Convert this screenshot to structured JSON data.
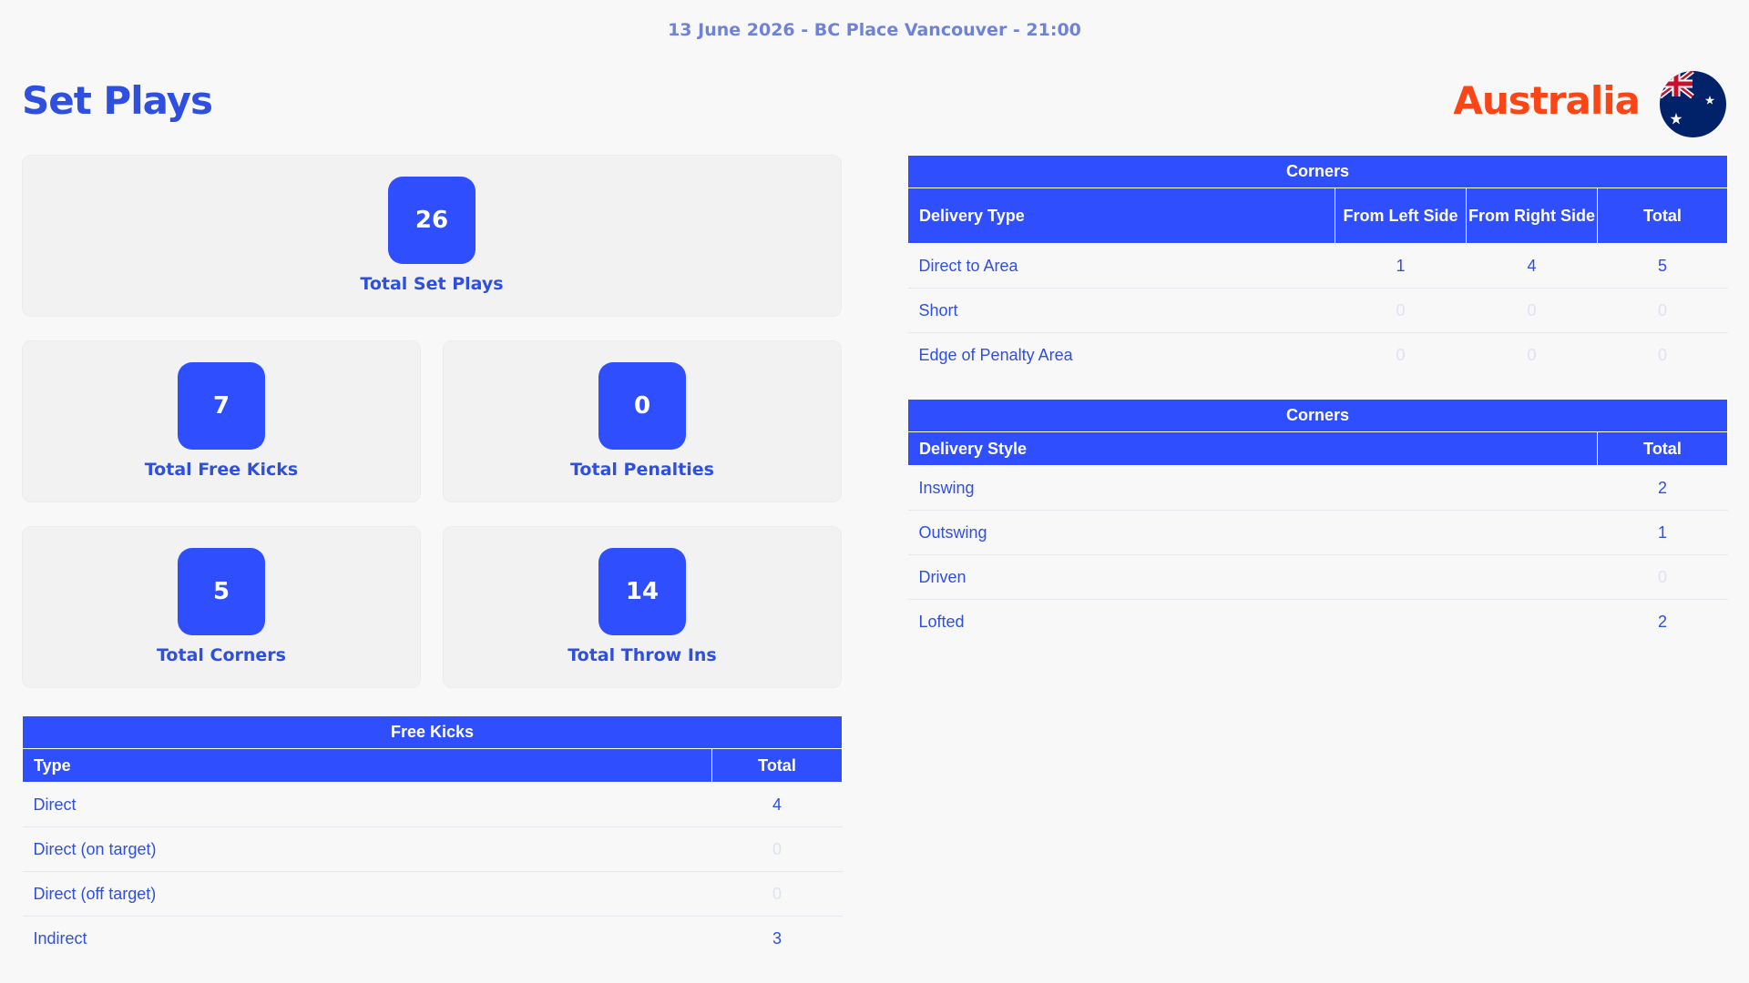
{
  "match_info": "13 June 2026 - BC Place Vancouver - 21:00",
  "page_title": "Set Plays",
  "team": {
    "name": "Australia",
    "flag_icon": "australia-flag-icon",
    "name_color": "#fa4616"
  },
  "colors": {
    "accent": "#2f4fff",
    "text": "#2f4fe0",
    "card_bg": "#f2f2f3",
    "zero_text": "#dfe3ee"
  },
  "stats": {
    "total_set_plays": {
      "value": "26",
      "label": "Total Set Plays"
    },
    "total_free_kicks": {
      "value": "7",
      "label": "Total Free Kicks"
    },
    "total_penalties": {
      "value": "0",
      "label": "Total Penalties"
    },
    "total_corners": {
      "value": "5",
      "label": "Total Corners"
    },
    "total_throw_ins": {
      "value": "14",
      "label": "Total Throw Ins"
    }
  },
  "free_kicks": {
    "caption": "Free Kicks",
    "headers": [
      "Type",
      "Total"
    ],
    "rows": [
      {
        "type": "Direct",
        "total": "4"
      },
      {
        "type": "Direct (on target)",
        "total": "0"
      },
      {
        "type": "Direct (off target)",
        "total": "0"
      },
      {
        "type": "Indirect",
        "total": "3"
      }
    ]
  },
  "corners_delivery_type": {
    "caption": "Corners",
    "headers": [
      "Delivery Type",
      "From Left Side",
      "From Right Side",
      "Total"
    ],
    "rows": [
      {
        "type": "Direct to Area",
        "left": "1",
        "right": "4",
        "total": "5"
      },
      {
        "type": "Short",
        "left": "0",
        "right": "0",
        "total": "0"
      },
      {
        "type": "Edge of Penalty Area",
        "left": "0",
        "right": "0",
        "total": "0"
      }
    ]
  },
  "corners_delivery_style": {
    "caption": "Corners",
    "headers": [
      "Delivery Style",
      "Total"
    ],
    "rows": [
      {
        "style": "Inswing",
        "total": "2"
      },
      {
        "style": "Outswing",
        "total": "1"
      },
      {
        "style": "Driven",
        "total": "0"
      },
      {
        "style": "Lofted",
        "total": "2"
      }
    ]
  }
}
